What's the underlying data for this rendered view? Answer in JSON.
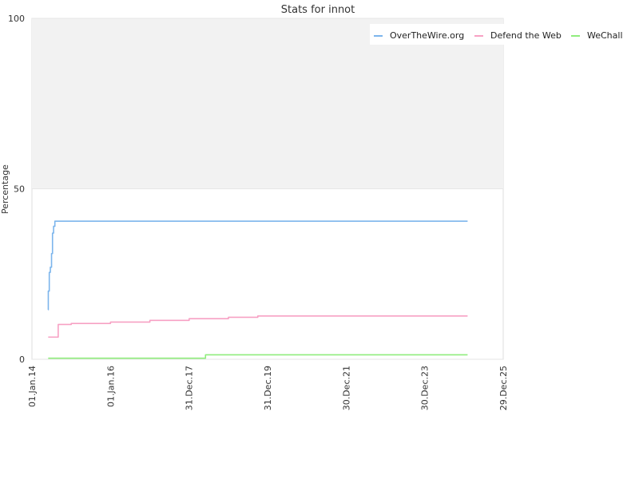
{
  "chart_data": {
    "type": "line",
    "title": "Stats for innot",
    "xlabel": "",
    "ylabel": "Percentage",
    "ylim": [
      0,
      100
    ],
    "xlim": [
      "2014-01-01",
      "2025-12-29"
    ],
    "y_ticks": [
      0,
      50,
      100
    ],
    "x_tick_dates": [
      "2014-01-01",
      "2016-01-01",
      "2017-12-31",
      "2019-12-31",
      "2021-12-30",
      "2023-12-30",
      "2025-12-29"
    ],
    "x_tick_labels": [
      "01.Jan.14",
      "01.Jan.16",
      "31.Dec.17",
      "31.Dec.19",
      "30.Dec.21",
      "30.Dec.23",
      "29.Dec.25"
    ],
    "shaded_band": [
      50,
      100
    ],
    "legend_position": "top-right",
    "grid": true,
    "series": [
      {
        "name": "OverTheWire.org",
        "color": "#7cb5ec",
        "points": [
          [
            "2014-06-01",
            14.5
          ],
          [
            "2014-06-02",
            20
          ],
          [
            "2014-06-10",
            20
          ],
          [
            "2014-06-11",
            25.5
          ],
          [
            "2014-06-20",
            25.5
          ],
          [
            "2014-06-21",
            27
          ],
          [
            "2014-07-01",
            27
          ],
          [
            "2014-07-02",
            31
          ],
          [
            "2014-07-10",
            31
          ],
          [
            "2014-07-11",
            37
          ],
          [
            "2014-07-20",
            37
          ],
          [
            "2014-07-21",
            39
          ],
          [
            "2014-08-01",
            39
          ],
          [
            "2014-08-02",
            40.5
          ],
          [
            "2025-02-01",
            40.5
          ]
        ]
      },
      {
        "name": "Defend the Web",
        "color": "#f7a1c4",
        "points": [
          [
            "2014-06-01",
            6.5
          ],
          [
            "2014-09-01",
            6.5
          ],
          [
            "2014-09-02",
            10.2
          ],
          [
            "2015-01-01",
            10.5
          ],
          [
            "2016-01-01",
            10.9
          ],
          [
            "2017-01-01",
            11.4
          ],
          [
            "2018-01-01",
            11.9
          ],
          [
            "2019-01-01",
            12.3
          ],
          [
            "2019-10-01",
            12.7
          ],
          [
            "2025-02-01",
            12.7
          ]
        ]
      },
      {
        "name": "WeChall",
        "color": "#90ed7d",
        "points": [
          [
            "2014-06-01",
            0.3
          ],
          [
            "2018-06-01",
            0.3
          ],
          [
            "2018-06-02",
            1.3
          ],
          [
            "2025-02-01",
            1.3
          ]
        ]
      }
    ]
  }
}
